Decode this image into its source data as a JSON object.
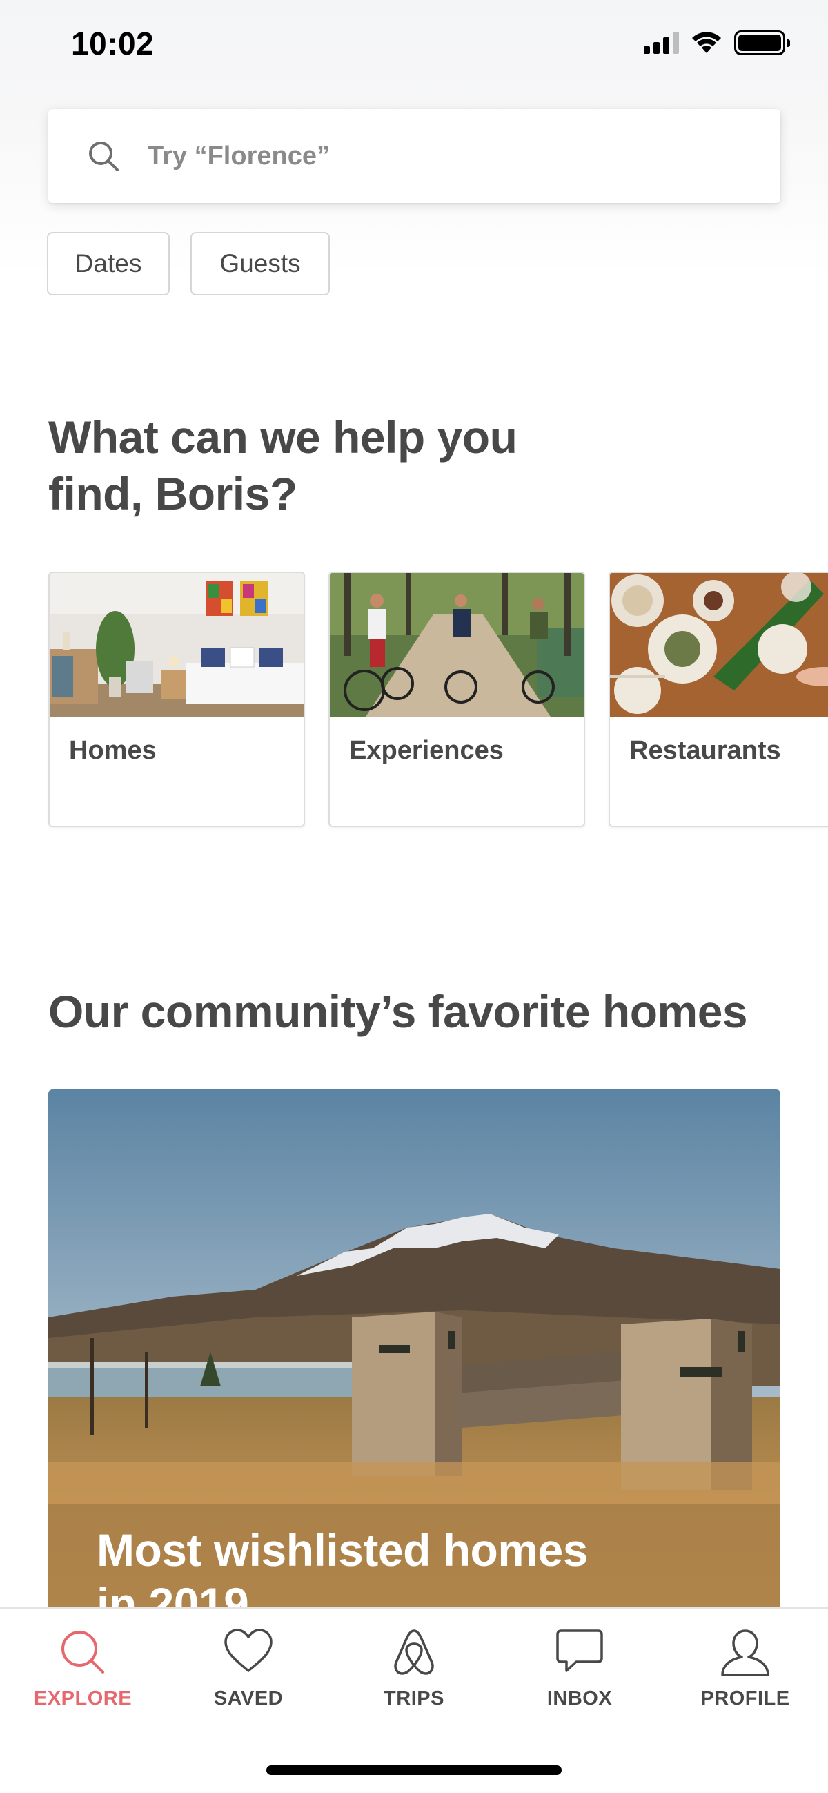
{
  "status_bar": {
    "time": "10:02"
  },
  "search": {
    "placeholder": "Try “Florence”"
  },
  "filters": {
    "dates": "Dates",
    "guests": "Guests"
  },
  "help_section": {
    "title_line1": "What can we help you",
    "title_line2": "find, Boris?"
  },
  "categories": [
    {
      "label": "Homes"
    },
    {
      "label": "Experiences"
    },
    {
      "label": "Restaurants"
    }
  ],
  "community_section": {
    "title": "Our community’s favorite homes"
  },
  "hero": {
    "title_line1": "Most wishlisted homes",
    "title_line2": "in 2019"
  },
  "tabs": [
    {
      "label": "EXPLORE",
      "icon": "search-icon",
      "active": true
    },
    {
      "label": "SAVED",
      "icon": "heart-icon",
      "active": false
    },
    {
      "label": "TRIPS",
      "icon": "airbnb-logo-icon",
      "active": false
    },
    {
      "label": "INBOX",
      "icon": "message-icon",
      "active": false
    },
    {
      "label": "PROFILE",
      "icon": "user-icon",
      "active": false
    }
  ],
  "colors": {
    "accent": "#e5686f",
    "text": "#484848",
    "muted": "#8a8a8a"
  }
}
